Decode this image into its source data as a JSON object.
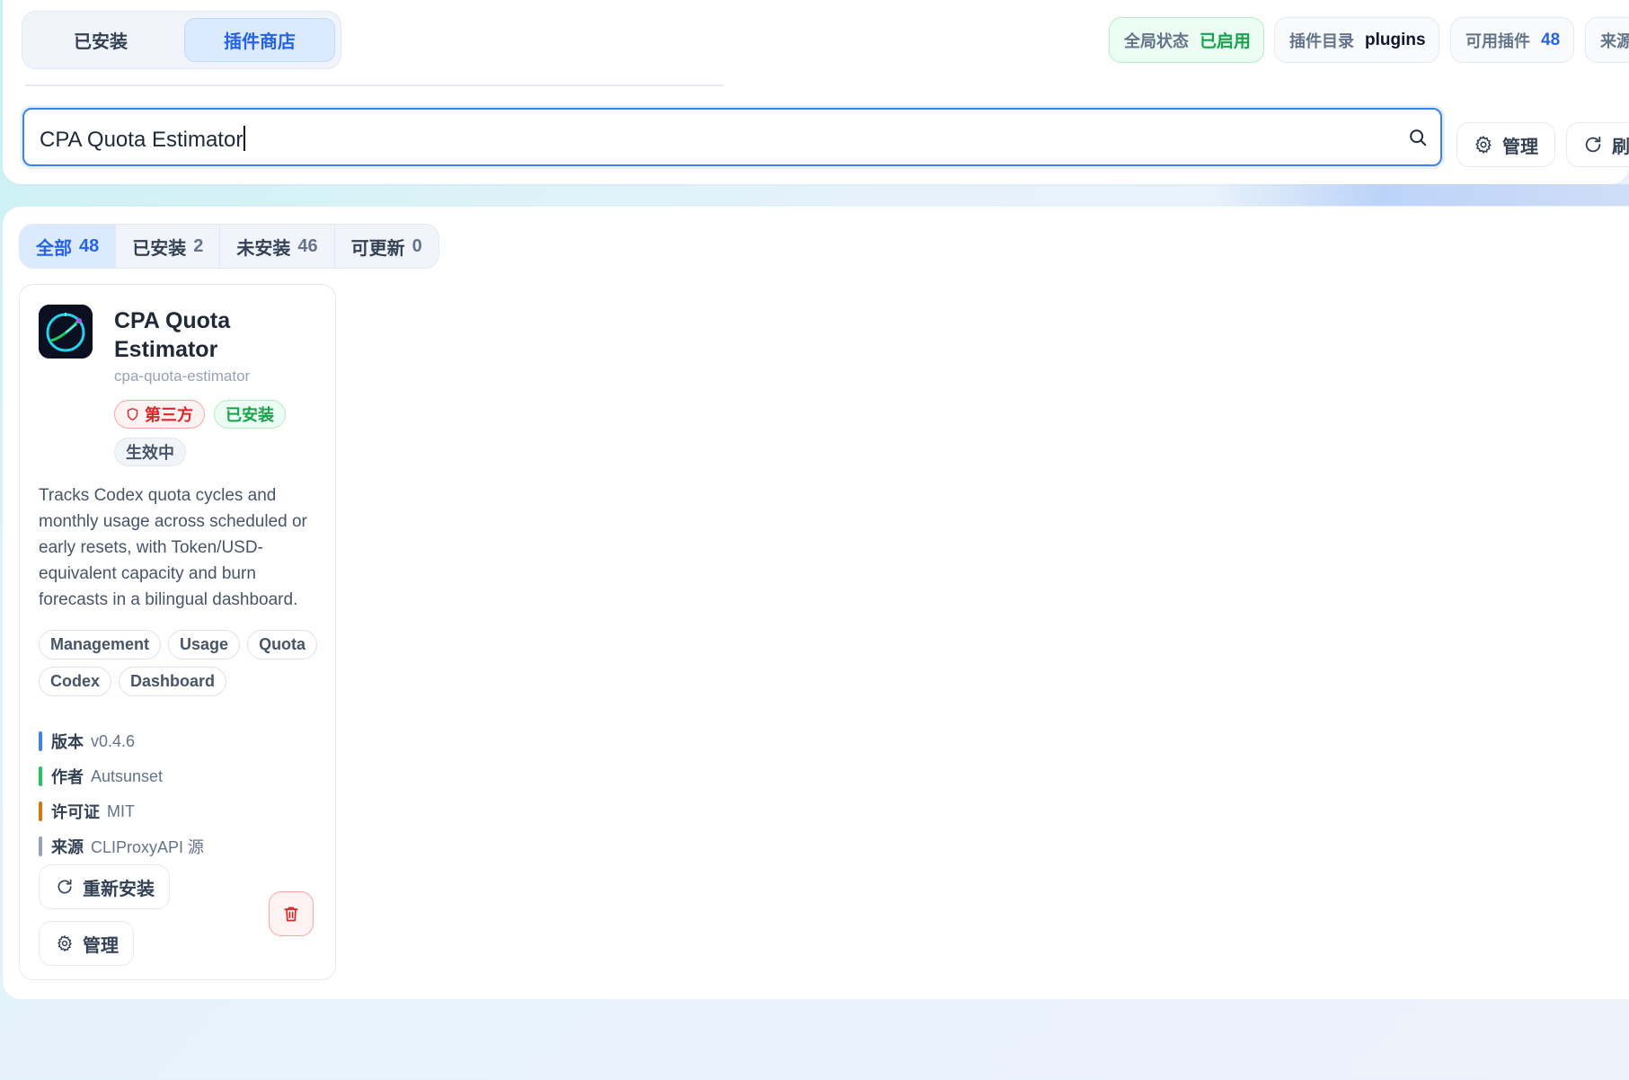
{
  "view_switch": {
    "installed": "已安装",
    "store": "插件商店"
  },
  "stats": {
    "global_label": "全局状态",
    "global_value": "已启用",
    "dir_label": "插件目录",
    "dir_value": "plugins",
    "count_label": "可用插件",
    "count_value": "48",
    "source_label": "来源"
  },
  "search": {
    "value": "CPA Quota Estimator"
  },
  "toolbar": {
    "manage": "管理",
    "refresh": "刷"
  },
  "filters": [
    {
      "label": "全部",
      "count": "48",
      "active": true
    },
    {
      "label": "已安装",
      "count": "2"
    },
    {
      "label": "未安装",
      "count": "46"
    },
    {
      "label": "可更新",
      "count": "0"
    }
  ],
  "card": {
    "title": "CPA Quota Estimator",
    "slug": "cpa-quota-estimator",
    "badge_third_party": "第三方",
    "badge_installed": "已安装",
    "badge_active": "生效中",
    "description": "Tracks Codex quota cycles and monthly usage across scheduled or early resets, with Token/USD-equivalent capacity and burn forecasts in a bilingual dashboard.",
    "tags": [
      "Management",
      "Usage",
      "Quota",
      "Codex",
      "Dashboard"
    ],
    "meta": {
      "version_label": "版本",
      "version": "v0.4.6",
      "author_label": "作者",
      "author": "Autsunset",
      "license_label": "许可证",
      "license": "MIT",
      "source_label": "来源",
      "source": "CLIProxyAPI 源"
    },
    "reinstall": "重新安装",
    "manage": "管理"
  },
  "colors": {
    "accent": "#2563eb",
    "success": "#16a34a",
    "danger": "#dc2626",
    "meta_version": "#3b82f6",
    "meta_author": "#22c55e",
    "meta_license": "#d97706",
    "meta_source": "#94a3b8"
  }
}
